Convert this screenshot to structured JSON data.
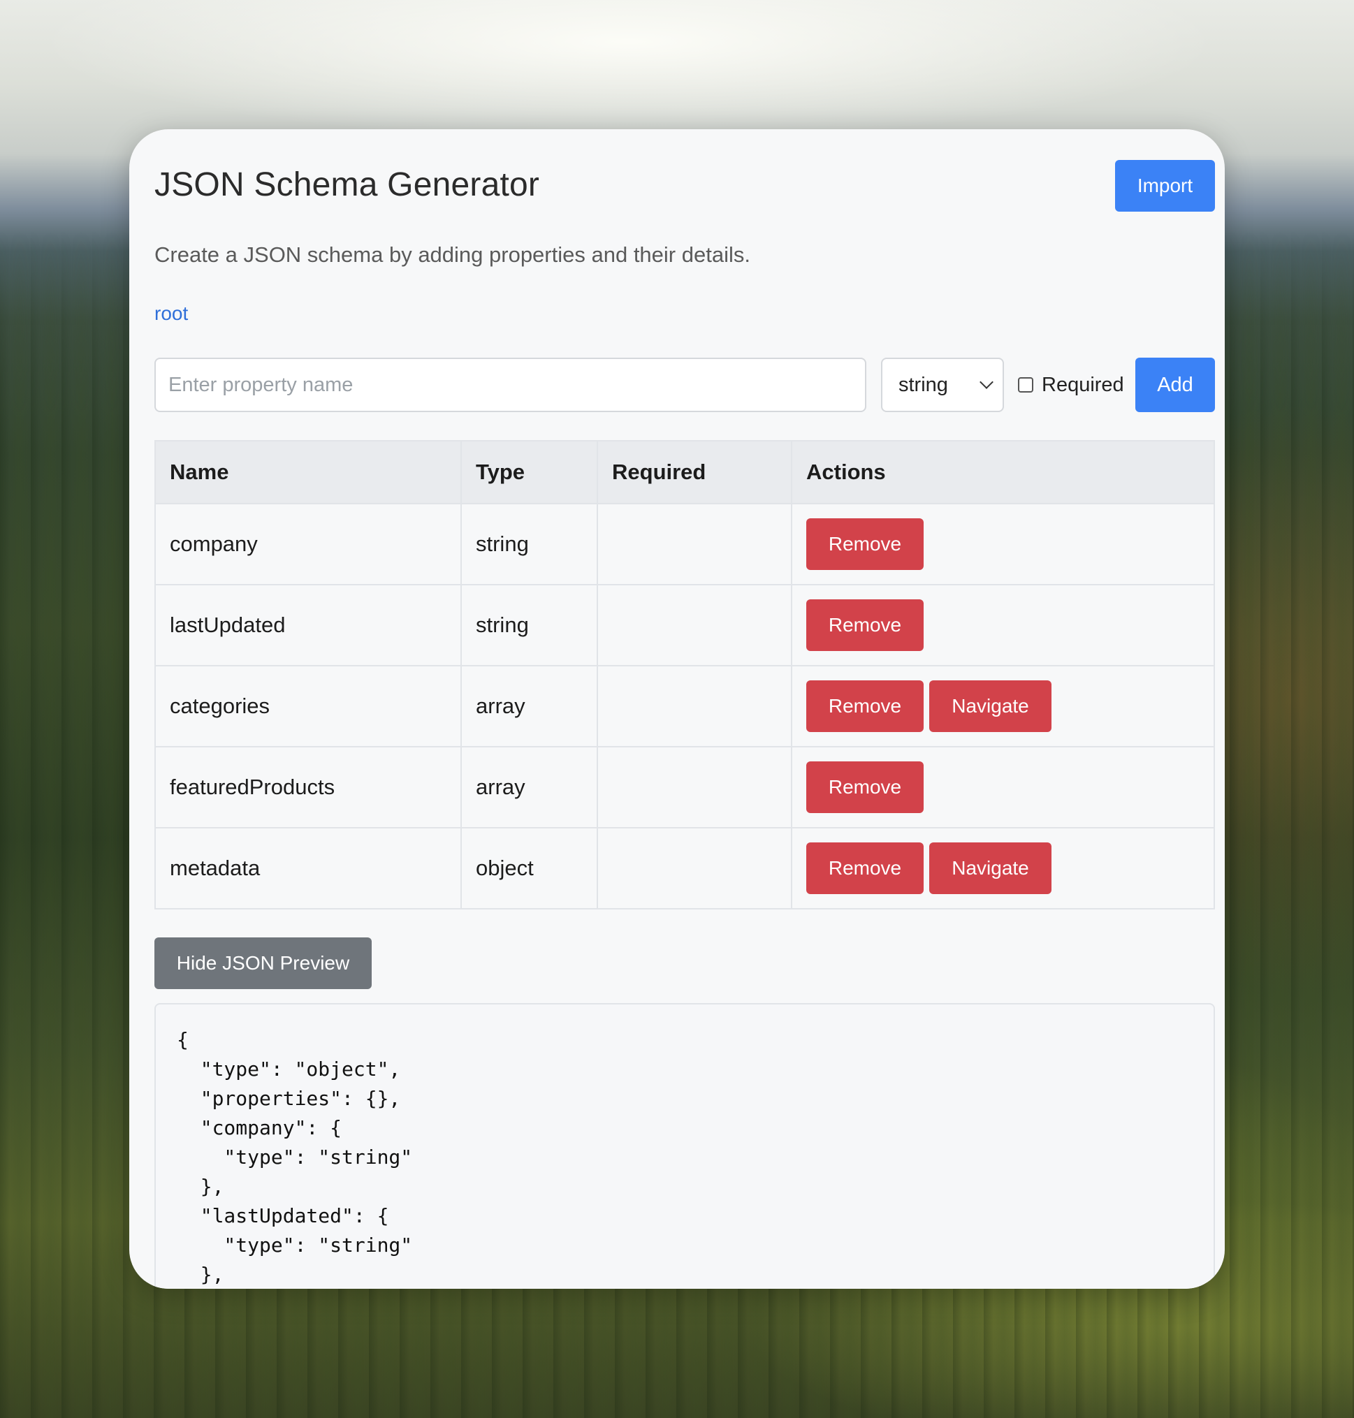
{
  "header": {
    "title": "JSON Schema Generator",
    "import_label": "Import"
  },
  "subtitle": "Create a JSON schema by adding properties and their details.",
  "breadcrumb": "root",
  "add_form": {
    "name_placeholder": "Enter property name",
    "name_value": "",
    "type_selected": "string",
    "required_label": "Required",
    "required_checked": false,
    "add_label": "Add"
  },
  "table": {
    "headers": [
      "Name",
      "Type",
      "Required",
      "Actions"
    ],
    "rows": [
      {
        "name": "company",
        "type": "string",
        "required": "",
        "actions": [
          "Remove"
        ]
      },
      {
        "name": "lastUpdated",
        "type": "string",
        "required": "",
        "actions": [
          "Remove"
        ]
      },
      {
        "name": "categories",
        "type": "array",
        "required": "",
        "actions": [
          "Remove",
          "Navigate"
        ]
      },
      {
        "name": "featuredProducts",
        "type": "array",
        "required": "",
        "actions": [
          "Remove"
        ]
      },
      {
        "name": "metadata",
        "type": "object",
        "required": "",
        "actions": [
          "Remove",
          "Navigate"
        ]
      }
    ]
  },
  "preview": {
    "toggle_label": "Hide JSON Preview",
    "json_text": "{\n  \"type\": \"object\",\n  \"properties\": {},\n  \"company\": {\n    \"type\": \"string\"\n  },\n  \"lastUpdated\": {\n    \"type\": \"string\"\n  },"
  },
  "colors": {
    "primary": "#3b82f6",
    "danger": "#d2424a",
    "secondary": "#6f757b",
    "link": "#2f6fd9"
  }
}
